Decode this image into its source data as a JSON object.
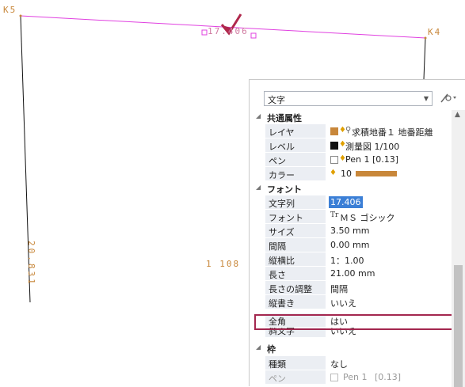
{
  "canvas": {
    "point_labels": {
      "k5": "K5",
      "k4": "K4"
    },
    "dimension_text_top": "17.406",
    "dimension_text_left": "20.831",
    "dimension_text_mid": "1 108",
    "colors": {
      "boundary": "#e040e0",
      "line": "#000000",
      "text": "#c8873a",
      "check": "#b0284c"
    }
  },
  "panel": {
    "type_selector": "文字",
    "tool_icon": "magic-wand-gear-icon",
    "sections": {
      "common": "共通属性",
      "font": "フォント",
      "frame": "枠"
    },
    "properties": {
      "layer": {
        "name": "レイヤ",
        "value": "求積地番１ 地番距離",
        "color": "#c8873a"
      },
      "level": {
        "name": "レベル",
        "value": "測量図 1/100",
        "color": "#111111"
      },
      "pen": {
        "name": "ペン",
        "value": "Pen 1 [0.13]"
      },
      "color": {
        "name": "カラー",
        "value": "10",
        "color": "#c8873a"
      },
      "text_string": {
        "name": "文字列",
        "value": "17.406"
      },
      "font": {
        "name": "フォント",
        "value": "ＭＳ ゴシック"
      },
      "size": {
        "name": "サイズ",
        "value": "3.50 mm"
      },
      "spacing": {
        "name": "間隔",
        "value": "0.00 mm"
      },
      "aspect": {
        "name": "縦横比",
        "value": "1：1.00"
      },
      "length": {
        "name": "長さ",
        "value": "21.00 mm"
      },
      "length_adjust": {
        "name": "長さの調整",
        "value": "間隔"
      },
      "vertical": {
        "name": "縦書き",
        "value": "いいえ"
      },
      "fullwidth": {
        "name": "全角",
        "value": "はい"
      },
      "italic": {
        "name": "斜文字",
        "value": "いいえ"
      },
      "frame_type": {
        "name": "種類",
        "value": "なし"
      },
      "frame_pen": {
        "name": "ペン",
        "value": "Pen 1",
        "extra": "[0.13]"
      }
    }
  }
}
